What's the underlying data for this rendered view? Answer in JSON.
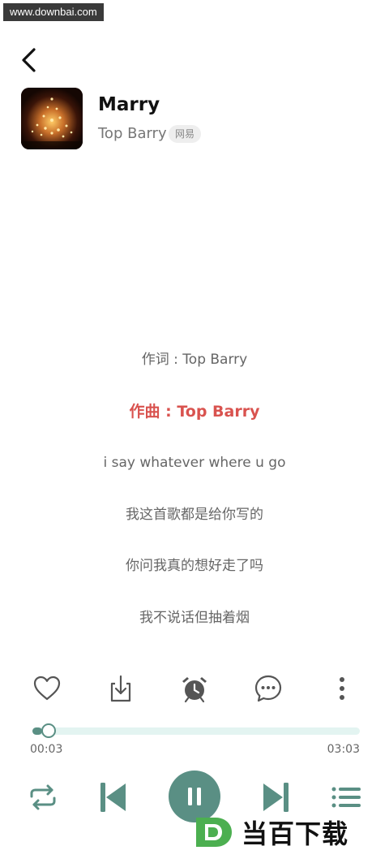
{
  "watermark": "www.downbai.com",
  "header": {
    "back_icon": "chevron-left-icon"
  },
  "song": {
    "title": "Marry",
    "artist": "Top Barry",
    "source_badge": "网易"
  },
  "lyrics": [
    {
      "text": "作词 : Top Barry",
      "active": false
    },
    {
      "text": "作曲 : Top Barry",
      "active": true
    },
    {
      "text": "i say whatever where u go",
      "active": false
    },
    {
      "text": "我这首歌都是给你写的",
      "active": false
    },
    {
      "text": "你问我真的想好走了吗",
      "active": false
    },
    {
      "text": "我不说话但抽着烟",
      "active": false
    }
  ],
  "actions": [
    "heart-icon",
    "download-icon",
    "alarm-icon",
    "comment-icon",
    "more-icon"
  ],
  "playback": {
    "elapsed": "00:03",
    "duration": "03:03",
    "progress": 0.016
  },
  "controls": [
    "repeat-icon",
    "previous-icon",
    "pause-icon",
    "next-icon",
    "playlist-icon"
  ],
  "colors": {
    "accent": "#5a8f84",
    "active_lyric": "#d9534f",
    "track": "#e3f4f1"
  },
  "brand": {
    "logo_letter": "D",
    "text": "当百下载"
  }
}
